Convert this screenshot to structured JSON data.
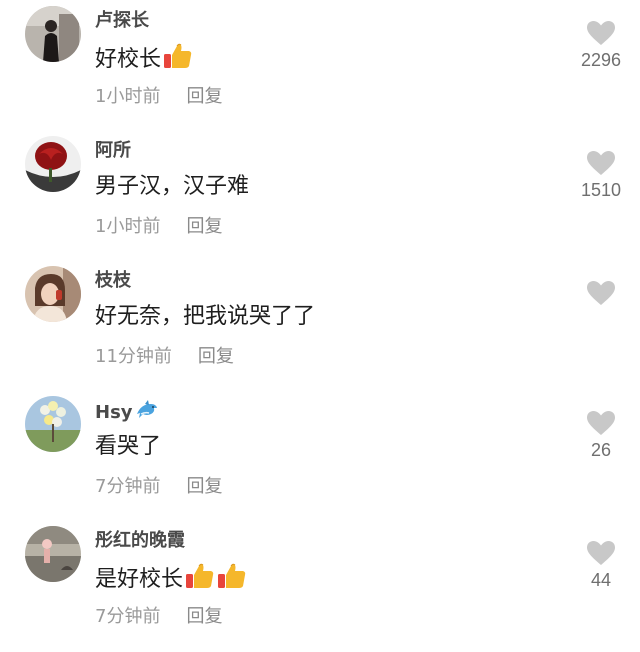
{
  "comments": [
    {
      "username": "卢探长",
      "text": "好校长",
      "emojis": [
        "thumbs-up"
      ],
      "time": "1小时前",
      "reply": "回复",
      "likes": "2296"
    },
    {
      "username": "阿所",
      "text": "男子汉，汉子难",
      "emojis": [],
      "time": "1小时前",
      "reply": "回复",
      "likes": "1510"
    },
    {
      "username": "枝枝",
      "text": "好无奈，把我说哭了了",
      "emojis": [],
      "time": "11分钟前",
      "reply": "回复",
      "likes": ""
    },
    {
      "username": "Hsy",
      "username_emoji": "dolphin",
      "text": "看哭了",
      "emojis": [],
      "time": "7分钟前",
      "reply": "回复",
      "likes": "26"
    },
    {
      "username": "彤红的晚霞",
      "text": "是好校长",
      "emojis": [
        "thumbs-up",
        "thumbs-up"
      ],
      "time": "7分钟前",
      "reply": "回复",
      "likes": "44"
    }
  ],
  "colors": {
    "heart": "#c8c8c8",
    "meta": "#9a9a9a",
    "username": "#4a4a4a",
    "text": "#1e1e1e"
  }
}
